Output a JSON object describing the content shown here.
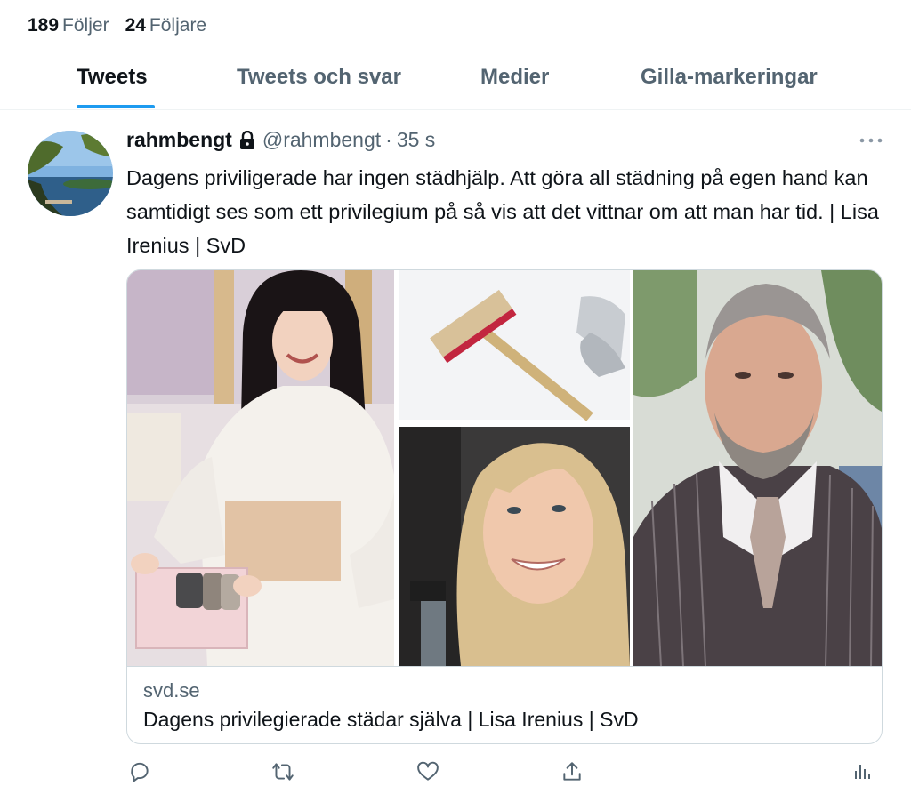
{
  "profile_stats": {
    "following_count": "189",
    "following_label": "Följer",
    "followers_count": "24",
    "followers_label": "Följare"
  },
  "tabs": [
    {
      "label": "Tweets",
      "active": true
    },
    {
      "label": "Tweets och svar",
      "active": false
    },
    {
      "label": "Medier",
      "active": false
    },
    {
      "label": "Gilla-markeringar",
      "active": false
    }
  ],
  "tweet": {
    "author_name": "rahmbengt",
    "handle": "@rahmbengt",
    "separator": "·",
    "time": "35 s",
    "text": "Dagens priviligerade har ingen städhjälp. Att göra all städning på egen hand kan samtidigt ses som ett privilegium på så vis att det vittnar om att man har tid. | Lisa Irenius | SvD",
    "card": {
      "domain": "svd.se",
      "title": "Dagens privilegierade städar själva | Lisa Irenius | SvD"
    }
  },
  "icons": {
    "lock": "lock-icon",
    "more": "more-icon",
    "reply": "reply-icon",
    "retweet": "retweet-icon",
    "like": "heart-icon",
    "share": "share-icon",
    "analytics": "analytics-icon"
  },
  "colors": {
    "accent": "#1d9bf0",
    "text_primary": "#0f1419",
    "text_secondary": "#536471",
    "border": "#cfd9de"
  }
}
